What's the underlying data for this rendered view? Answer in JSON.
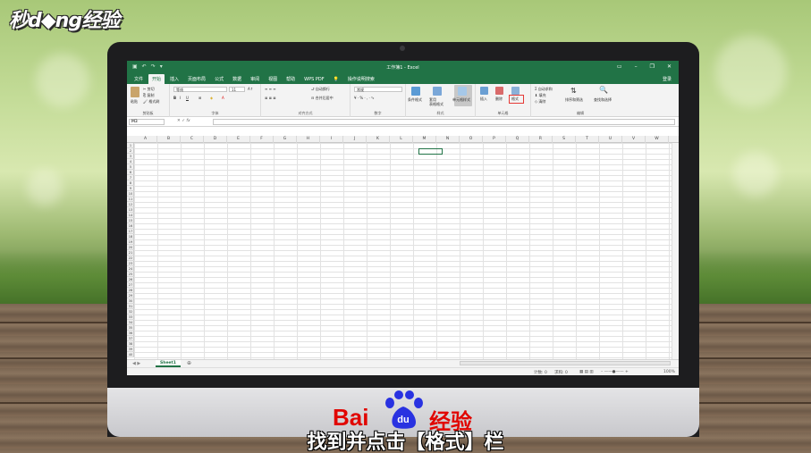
{
  "brand": "秒d◆ng经验",
  "excel": {
    "title": "工作簿1 - Excel",
    "user": "登录",
    "tabs": [
      "文件",
      "开始",
      "插入",
      "页面布局",
      "公式",
      "数据",
      "审阅",
      "视图",
      "帮助",
      "WPS PDF",
      "操作说明搜索"
    ],
    "active_tab": "开始",
    "ribbon": {
      "clipboard": {
        "paste": "粘贴",
        "cut": "剪切",
        "copy": "复制",
        "format_painter": "格式刷",
        "label": "剪贴板"
      },
      "font": {
        "name": "等线",
        "size": "11",
        "label": "字体",
        "bold": "B",
        "italic": "I",
        "underline": "U"
      },
      "alignment": {
        "wrap": "自动换行",
        "merge": "合并后居中",
        "label": "对齐方式"
      },
      "number": {
        "format": "常规",
        "label": "数字"
      },
      "styles": {
        "conditional": "条件格式",
        "table": "套用\n表格格式",
        "cell_styles": "单元格样式",
        "label": "样式"
      },
      "cells": {
        "insert": "插入",
        "delete": "删除",
        "format": "格式",
        "label": "单元格"
      },
      "editing": {
        "autosum": "自动求和",
        "fill": "填充",
        "clear": "清除",
        "sort": "排序和筛选",
        "find": "查找和选择",
        "label": "编辑"
      }
    },
    "namebox": "M3",
    "fx": "fx",
    "columns": [
      "A",
      "B",
      "C",
      "D",
      "E",
      "F",
      "G",
      "H",
      "I",
      "J",
      "K",
      "L",
      "M",
      "N",
      "O",
      "P",
      "Q",
      "R",
      "S",
      "T",
      "U",
      "V",
      "W"
    ],
    "rows": [
      "1",
      "2",
      "3",
      "4",
      "5",
      "6",
      "7",
      "8",
      "9",
      "10",
      "11",
      "12",
      "13",
      "14",
      "15",
      "16",
      "17",
      "18",
      "19",
      "20",
      "21",
      "22",
      "23",
      "24",
      "25",
      "26",
      "27",
      "28",
      "29",
      "30",
      "31",
      "32",
      "33",
      "34",
      "35",
      "36",
      "37",
      "38",
      "39",
      "40"
    ],
    "sheet": "Sheet1",
    "status": {
      "count": "计数: 0",
      "sum": "求和: 0",
      "zoom": "100%"
    }
  },
  "watermark": {
    "bai": "Bai",
    "du": "du",
    "jy": "经验"
  },
  "caption": "找到并点击【格式】栏",
  "colors": {
    "excel_green": "#217346",
    "highlight": "#e53935",
    "baidu_red": "#e10601"
  }
}
